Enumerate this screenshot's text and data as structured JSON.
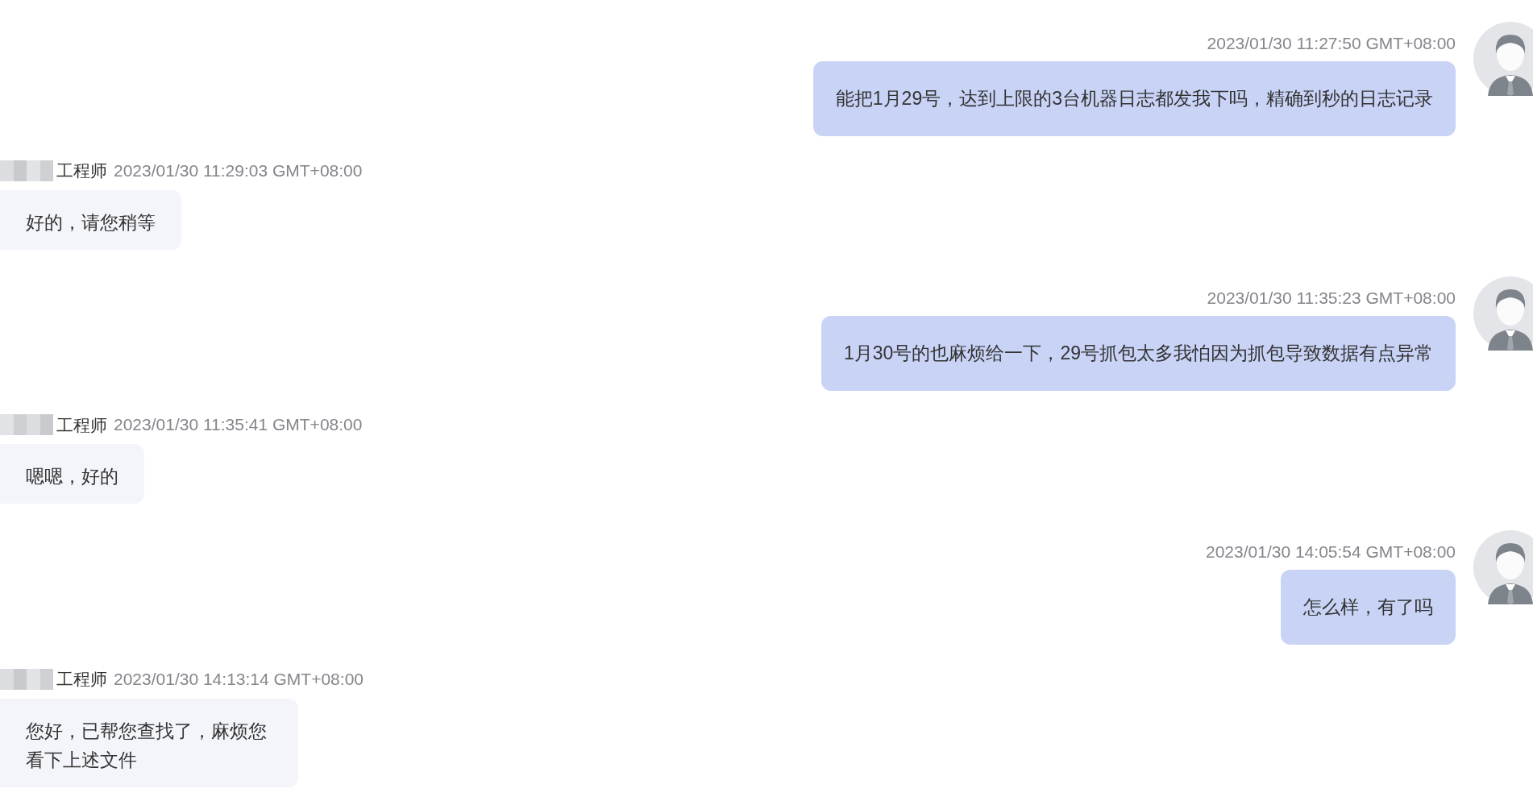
{
  "messages": [
    {
      "kind": "sent",
      "time": "2023/01/30 11:27:50 GMT+08:00",
      "text": "能把1月29号，达到上限的3台机器日志都发我下吗，精确到秒的日志记录"
    },
    {
      "kind": "received",
      "sender": "工程师",
      "redacted": true,
      "time": "2023/01/30 11:29:03 GMT+08:00",
      "text": "好的，请您稍等"
    },
    {
      "kind": "sent",
      "time": "2023/01/30 11:35:23 GMT+08:00",
      "text": "1月30号的也麻烦给一下，29号抓包太多我怕因为抓包导致数据有点异常"
    },
    {
      "kind": "received",
      "sender": "工程师",
      "redacted": true,
      "time": "2023/01/30 11:35:41 GMT+08:00",
      "text": "嗯嗯，好的"
    },
    {
      "kind": "sent",
      "time": "2023/01/30 14:05:54 GMT+08:00",
      "text": "怎么样，有了吗"
    },
    {
      "kind": "received",
      "sender": "工程师",
      "redacted": true,
      "time": "2023/01/30 14:13:14 GMT+08:00",
      "text": "您好，已帮您查找了，麻烦您看下上述文件"
    }
  ]
}
